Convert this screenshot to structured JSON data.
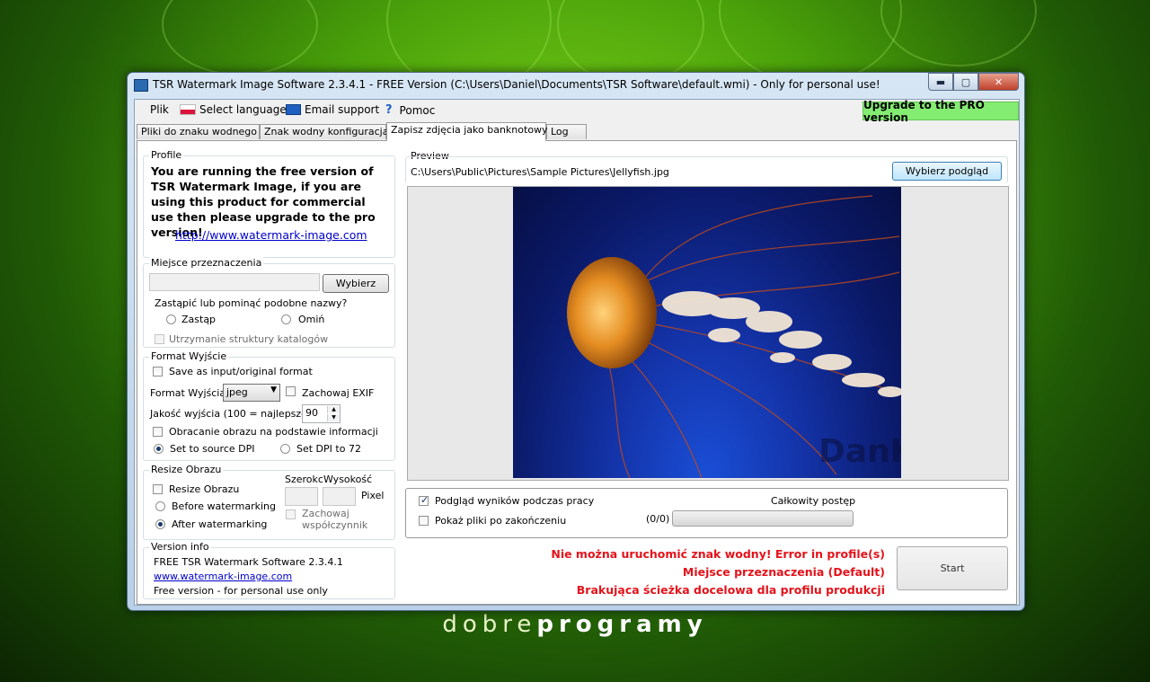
{
  "window": {
    "title": "TSR Watermark Image Software 2.3.4.1 - FREE Version (C:\\Users\\Daniel\\Documents\\TSR Software\\default.wmi) - Only for personal use!",
    "min": "▬",
    "max": "▢",
    "close": "✕"
  },
  "menu": {
    "file": "Plik",
    "language": "Select language",
    "email": "Email support",
    "help": "Pomoc",
    "help_icon": "?",
    "upgrade": "Upgrade to the PRO version"
  },
  "tabs": [
    {
      "label": "Pliki do znaku wodnego"
    },
    {
      "label": "Znak wodny konfiguracja"
    },
    {
      "label": "Zapisz zdjęcia jako banknotowy"
    },
    {
      "label": "Log"
    }
  ],
  "profile": {
    "legend": "Profile",
    "notice": "You are running the free version of TSR Watermark Image, if you are using this product for commercial use then please upgrade to the pro version!",
    "link": "http://www.watermark-image.com"
  },
  "destination": {
    "legend": "Miejsce przeznaczenia",
    "path_value": "",
    "browse": "Wybierz",
    "replace_question": "Zastąpić lub pominąć podobne nazwy?",
    "replace": "Zastąp",
    "skip": "Omiń",
    "keep_structure": "Utrzymanie struktury katalogów"
  },
  "format": {
    "legend": "Format Wyjście",
    "save_as_input": "Save as input/original format",
    "output_format_label": "Format Wyjścia",
    "output_format_value": "jpeg",
    "keep_exif": "Zachowaj EXIF",
    "quality_label": "Jakość wyjścia (100 = najlepsze)",
    "quality_value": "90",
    "rotate": "Obracanie obrazu na podstawie informacji",
    "source_dpi": "Set to source DPI",
    "dpi72": "Set DPI to 72"
  },
  "resize": {
    "legend": "Resize Obrazu",
    "resize_cb": "Resize Obrazu",
    "width_label": "Szerokc",
    "height_label": "Wysokość",
    "before": "Before watermarking",
    "after": "After watermarking",
    "pixel": "Pixel",
    "keep_ratio_1": "Zachowaj",
    "keep_ratio_2": "współczynnik"
  },
  "version": {
    "legend": "Version info",
    "line1": "FREE TSR Watermark Software 2.3.4.1",
    "link": "www.watermark-image.com",
    "line3": "Free version - for personal use only"
  },
  "preview": {
    "legend": "Preview",
    "path": "C:\\Users\\Public\\Pictures\\Sample Pictures\\Jellyfish.jpg",
    "choose": "Wybierz podgląd",
    "watermark": "DanKar.pl"
  },
  "bottom": {
    "preview_results": "Podgląd wyników podczas pracy",
    "show_files": "Pokaż pliki po zakończeniu",
    "total_progress": "Całkowity postęp",
    "count": "(0/0)",
    "progress_fraction": 0
  },
  "errors": {
    "line1": "Nie można uruchomić znak wodny!  Error in profile(s)",
    "line2": "Miejsce przeznaczenia (Default)",
    "line3": "Brakująca ścieżka docelowa dla profilu produkcji"
  },
  "start": "Start",
  "branding": {
    "part1": "dobre",
    "part2": "programy"
  },
  "colors": {
    "upgrade_bg": "#84ec72",
    "error_text": "#e3131b",
    "desktop": "#4aa10a"
  }
}
